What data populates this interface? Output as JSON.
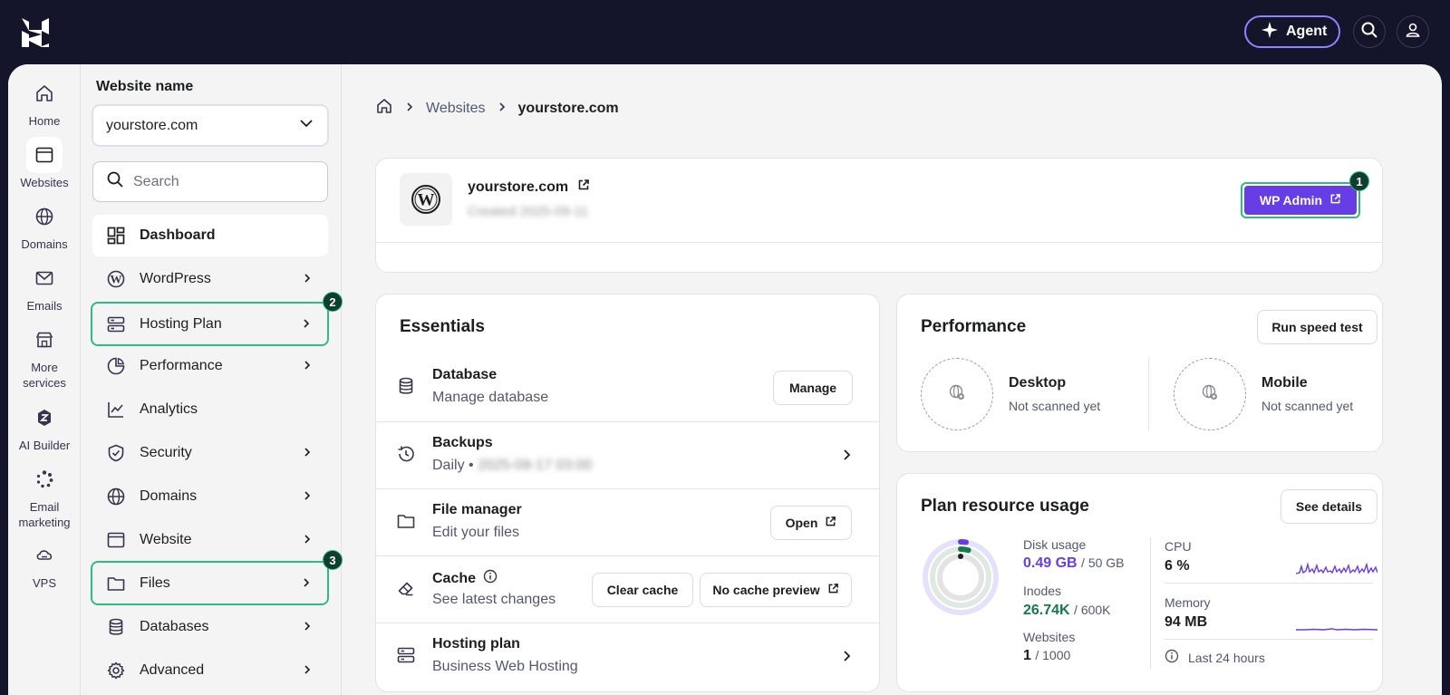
{
  "topbar": {
    "agent_label": "Agent"
  },
  "rail": [
    {
      "label": "Home"
    },
    {
      "label": "Websites"
    },
    {
      "label": "Domains"
    },
    {
      "label": "Emails"
    },
    {
      "label": "More services"
    },
    {
      "label": "AI Builder"
    },
    {
      "label": "Email marketing"
    },
    {
      "label": "VPS"
    }
  ],
  "subnav": {
    "title": "Website name",
    "selected_site": "yourstore.com",
    "search_placeholder": "Search",
    "items": [
      {
        "label": "Dashboard"
      },
      {
        "label": "WordPress"
      },
      {
        "label": "Hosting Plan",
        "badge": "2"
      },
      {
        "label": "Performance"
      },
      {
        "label": "Analytics"
      },
      {
        "label": "Security"
      },
      {
        "label": "Domains"
      },
      {
        "label": "Website"
      },
      {
        "label": "Files",
        "badge": "3"
      },
      {
        "label": "Databases"
      },
      {
        "label": "Advanced"
      }
    ]
  },
  "breadcrumb": {
    "section": "Websites",
    "current": "yourstore.com"
  },
  "site": {
    "name": "yourstore.com",
    "created": "Created 2025-09-11",
    "wp_admin_label": "WP Admin",
    "wp_admin_badge": "1"
  },
  "essentials": {
    "title": "Essentials",
    "rows": [
      {
        "title": "Database",
        "subtitle": "Manage database",
        "action": "Manage"
      },
      {
        "title": "Backups",
        "subtitle_prefix": "Daily • ",
        "subtitle_blurred": "2025-09-17 03:00"
      },
      {
        "title": "File manager",
        "subtitle": "Edit your files",
        "action": "Open"
      },
      {
        "title": "Cache",
        "subtitle": "See latest changes",
        "action": "Clear cache",
        "action2": "No cache preview"
      },
      {
        "title": "Hosting plan",
        "subtitle": "Business Web Hosting"
      }
    ]
  },
  "performance": {
    "title": "Performance",
    "button": "Run speed test",
    "desktop": {
      "title": "Desktop",
      "status": "Not scanned yet"
    },
    "mobile": {
      "title": "Mobile",
      "status": "Not scanned yet"
    }
  },
  "plan_usage": {
    "title": "Plan resource usage",
    "button": "See details",
    "disk": {
      "label": "Disk usage",
      "value": "0.49 GB",
      "limit": "/ 50 GB",
      "fraction": 0.0098
    },
    "inodes": {
      "label": "Inodes",
      "value": "26.74K",
      "limit": "/ 600K",
      "fraction": 0.0446
    },
    "websites": {
      "label": "Websites",
      "value": "1",
      "limit": "/ 1000"
    },
    "cpu": {
      "label": "CPU",
      "value": "6 %"
    },
    "memory": {
      "label": "Memory",
      "value": "94 MB"
    },
    "period": "Last 24 hours"
  },
  "colors": {
    "accent": "#673de6",
    "highlight": "#2fbb86",
    "topbar": "#14142b"
  }
}
